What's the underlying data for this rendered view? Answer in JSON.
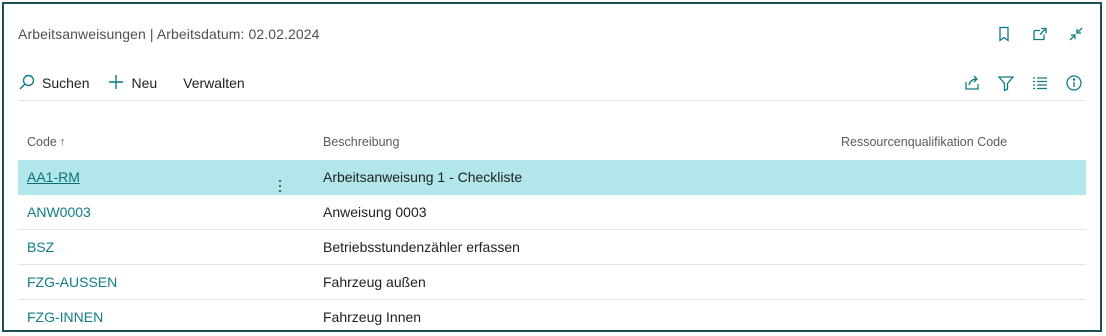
{
  "page": {
    "title": "Arbeitsanweisungen | Arbeitsdatum: 02.02.2024",
    "title_icons": [
      "bookmark-icon",
      "open-new-window-icon",
      "collapse-icon"
    ]
  },
  "toolbar": {
    "search_label": "Suchen",
    "new_label": "Neu",
    "manage_label": "Verwalten",
    "right_icons": [
      "share-icon",
      "filter-icon",
      "list-view-icon",
      "info-icon"
    ]
  },
  "table": {
    "columns": {
      "code": "Code",
      "code_sort": "↑",
      "description": "Beschreibung",
      "qualification": "Ressourcenqualifikation Code"
    },
    "rows": [
      {
        "code": "AA1-RM",
        "description": "Arbeitsanweisung 1 - Checkliste",
        "qualification": "",
        "selected": true
      },
      {
        "code": "ANW0003",
        "description": "Anweisung 0003",
        "qualification": ""
      },
      {
        "code": "BSZ",
        "description": "Betriebsstundenzähler erfassen",
        "qualification": ""
      },
      {
        "code": "FZG-AUSSEN",
        "description": "Fahrzeug außen",
        "qualification": ""
      },
      {
        "code": "FZG-INNEN",
        "description": "Fahrzeug Innen",
        "qualification": ""
      }
    ]
  },
  "colors": {
    "accent": "#0f7c86",
    "selected_row": "#b1e7ea",
    "frame_border": "#1d4f5b"
  }
}
